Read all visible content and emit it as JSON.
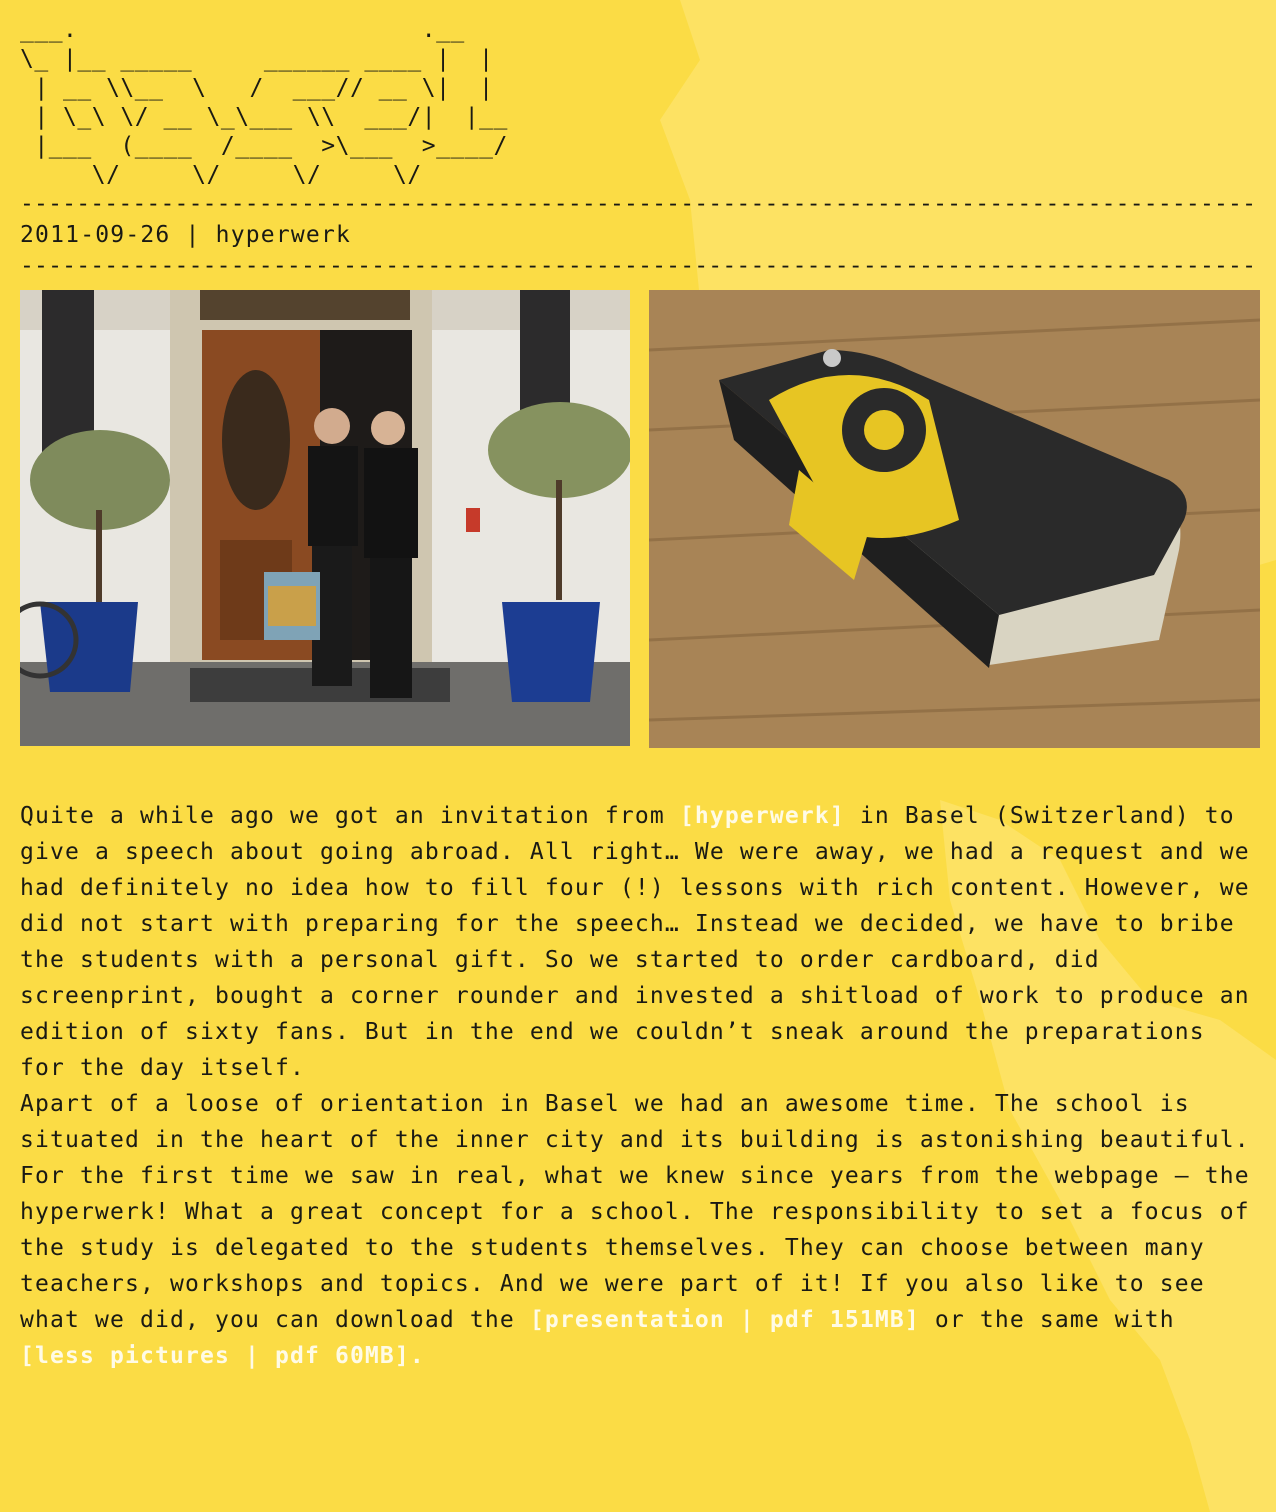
{
  "header": {
    "ascii_logo": "___.                        .__\n\\_ |__ _____     ______ ____ |  |\n | __ \\\\__  \\   /  ___// __ \\|  |\n | \\_\\ \\/ __ \\_\\___ \\\\  ___/|  |__\n |___  (____  /____  >\\___  >____/\n     \\/     \\/     \\/     \\/",
    "separator": "------------------------------------------------------------------------------------------------------------"
  },
  "post": {
    "date": "2011-09-26",
    "divider": " | ",
    "tag": "hyperwerk"
  },
  "photos": [
    {
      "name": "photo-hyperwerk-entrance"
    },
    {
      "name": "photo-fan-edition"
    }
  ],
  "article": {
    "p1_a": "Quite a while ago we got an invitation from ",
    "link_hyperwerk": "[hyperwerk]",
    "p1_b": " in Basel (Switzerland) to give a speech about going abroad. All right… We were away, we had a request and we had definitely no idea how to fill four (!) lessons with rich content. However, we did not start with preparing for the speech… Instead we decided, we have to bribe the students with a personal gift. So we started to order cardboard, did screenprint, bought a corner rounder and invested a shitload of work to produce an edition of sixty fans. But in the end we couldn’t sneak around the preparations for the day itself.",
    "p2_a": "Apart of a loose of orientation in Basel we had an awesome time. The school is situated in the heart of the inner city and its building is astonishing beautiful. For the first time we saw in real, what we knew since years from the webpage – the hyperwerk! What a great concept for a school. The responsibility to set a focus of the study is delegated to the students themselves. They can choose between many teachers, workshops and topics. And we were part of it! If you also like to see what we did, you can download the ",
    "link_presentation": "[presentation | pdf 151MB]",
    "p2_b": " or the same with ",
    "link_less": "[less pictures | pdf 60MB].",
    "link_color": "#fffbe6"
  }
}
